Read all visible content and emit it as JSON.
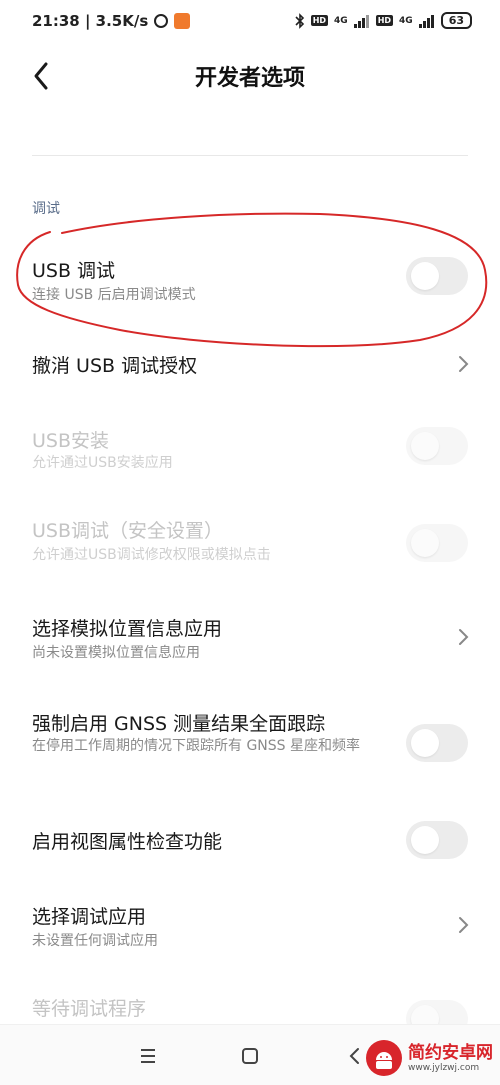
{
  "status_bar": {
    "time_speed": "21:38 | 3.5K/s",
    "sim1_network": "4G",
    "sim2_network": "4G",
    "hd_label": "HD",
    "battery": "63"
  },
  "header": {
    "title": "开发者选项"
  },
  "section": {
    "label": "调试"
  },
  "items": [
    {
      "title": "USB 调试",
      "subtitle": "连接 USB 后启用调试模式"
    },
    {
      "title": "撤消 USB 调试授权"
    },
    {
      "title": "USB安装",
      "subtitle": "允许通过USB安装应用"
    },
    {
      "title": "USB调试（安全设置）",
      "subtitle": "允许通过USB调试修改权限或模拟点击"
    },
    {
      "title": "选择模拟位置信息应用",
      "subtitle": "尚未设置模拟位置信息应用"
    },
    {
      "title": "强制启用 GNSS 测量结果全面跟踪",
      "subtitle": "在停用工作周期的情况下跟踪所有 GNSS 星座和频率"
    },
    {
      "title": "启用视图属性检查功能"
    },
    {
      "title": "选择调试应用",
      "subtitle": "未设置任何调试应用"
    },
    {
      "title": "等待调试程序"
    }
  ],
  "toggle_states": {
    "usb_debugging": false,
    "usb_install": false,
    "usb_debugging_security": false,
    "gnss": false,
    "view_attr": false,
    "wait_debugger": false
  },
  "colors": {
    "annotation": "#d62828",
    "accent_section": "#5a6d8a",
    "watermark": "#d8252b"
  },
  "watermark": {
    "brand": "简约安卓网",
    "url": "www.jylzwj.com"
  }
}
